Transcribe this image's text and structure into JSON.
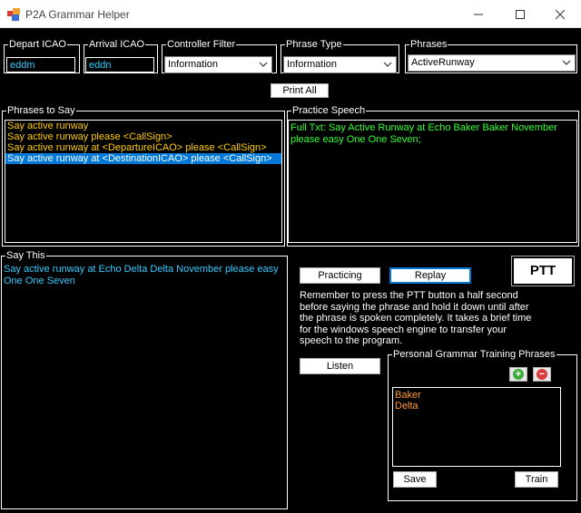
{
  "window": {
    "title": "P2A Grammar Helper"
  },
  "controls": {
    "depart_icao": {
      "label": "Depart ICAO",
      "value": "eddm"
    },
    "arrival_icao": {
      "label": "Arrival ICAO",
      "value": "eddn"
    },
    "controller_filter": {
      "label": "Controller Filter",
      "selected": "Information"
    },
    "phrase_type": {
      "label": "Phrase Type",
      "selected": "Information"
    },
    "phrases": {
      "label": "Phrases",
      "selected": "ActiveRunway"
    },
    "print_all_label": "Print All"
  },
  "phrases_to_say": {
    "label": "Phrases to Say",
    "items": [
      "Say active runway",
      "Say active runway please <CallSign>",
      "Say active runway at <DepartureICAO> please <CallSign>",
      "Say active runway at <DestinationICAO> please <CallSign>"
    ],
    "selected_index": 3
  },
  "practice_speech": {
    "label": "Practice Speech",
    "text": "Full Txt:  Say Active Runway at Echo Baker Baker November please easy One One Seven;"
  },
  "say_this": {
    "label": "Say This",
    "text": "Say active runway at Echo Delta Delta November please easy One One Seven"
  },
  "buttons": {
    "practicing": "Practicing",
    "replay": "Replay",
    "ptt": "PTT",
    "listen": "Listen",
    "save": "Save",
    "train": "Train"
  },
  "instructions": "Remember to press the PTT button a half second before saying the phrase and hold it down until after the phrase is spoken completely.  It takes a brief time for the windows speech engine to transfer your speech to the program.",
  "personal_grammar": {
    "label": "Personal Grammar Training Phrases",
    "items": [
      "Baker",
      "Delta"
    ]
  },
  "colors": {
    "background": "#000000",
    "list_text": "#ffcc00",
    "practice_text": "#33ff33",
    "say_this_text": "#33ccff",
    "selection": "#0078d7"
  },
  "icons": [
    "app-icon",
    "minimize-icon",
    "maximize-icon",
    "close-icon",
    "chevron-down-icon",
    "add-icon",
    "remove-icon"
  ]
}
